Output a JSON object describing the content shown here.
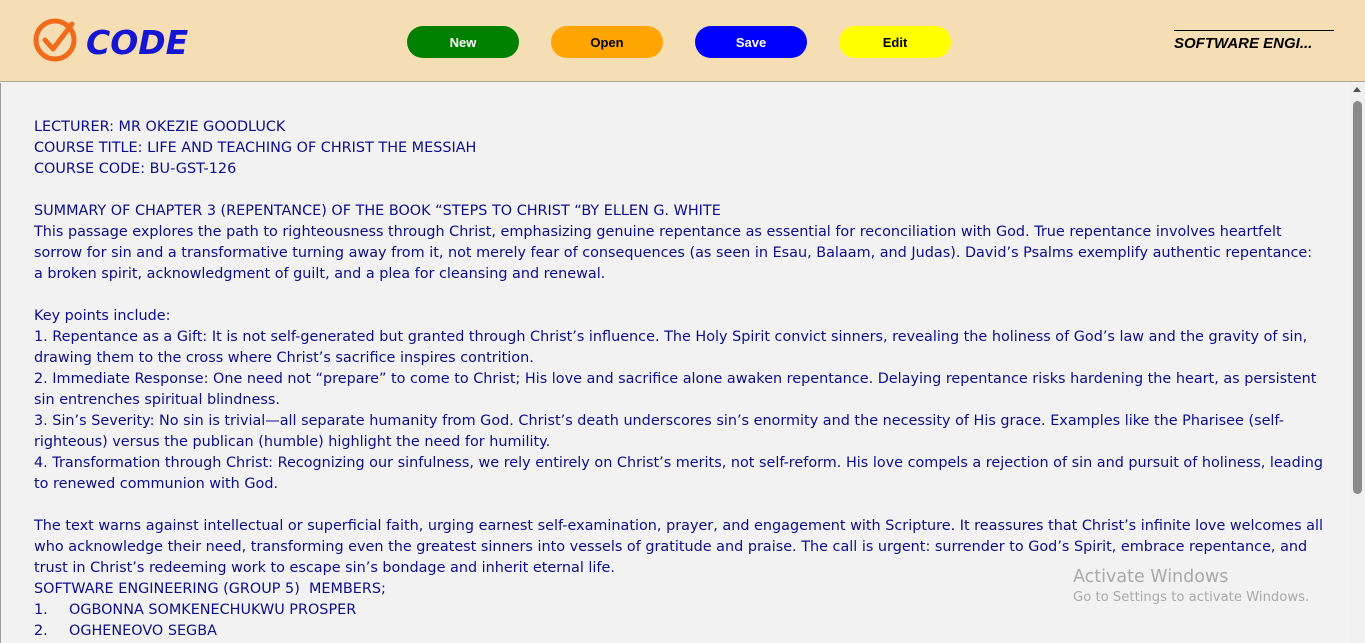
{
  "logo": {
    "icon": "check-circle-icon",
    "text": "CODE",
    "icon_color": "#f26b1d",
    "text_color": "#1515d4"
  },
  "toolbar": {
    "new_label": "New",
    "open_label": "Open",
    "save_label": "Save",
    "edit_label": "Edit",
    "colors": {
      "new": "#008000",
      "open": "#ffa500",
      "save": "#0000ff",
      "edit": "#ffff00"
    }
  },
  "brand_right": "SOFTWARE ENGI...",
  "document": {
    "lecturer": "LECTURER: MR OKEZIE GOODLUCK",
    "course_title": "COURSE TITLE: LIFE AND TEACHING OF CHRIST THE MESSIAH",
    "course_code": "COURSE CODE: BU-GST-126",
    "summary_heading": "SUMMARY OF CHAPTER 3 (REPENTANCE) OF THE BOOK “STEPS TO CHRIST “BY ELLEN G. WHITE",
    "intro": "This passage explores the path to righteousness through Christ, emphasizing genuine repentance as essential for reconciliation with God. True repentance involves heartfelt sorrow for sin and a transformative turning away from it, not merely fear of consequences (as seen in Esau, Balaam, and Judas). David’s Psalms exemplify authentic repentance: a broken spirit, acknowledgment of guilt, and a plea for cleansing and renewal.",
    "key_points_heading": "Key points include:",
    "points": [
      "1. Repentance as a Gift: It is not self-generated but granted through Christ’s influence. The Holy Spirit convict sinners, revealing the holiness of God’s law and the gravity of sin, drawing them to the cross where Christ’s sacrifice inspires contrition.",
      "2. Immediate Response: One need not “prepare” to come to Christ; His love and sacrifice alone awaken repentance. Delaying repentance risks hardening the heart, as persistent sin entrenches spiritual blindness.",
      "3. Sin’s Severity: No sin is trivial—all separate humanity from God. Christ’s death underscores sin’s enormity and the necessity of His grace. Examples like the Pharisee (self-righteous) versus the publican (humble) highlight the need for humility.",
      "4. Transformation through Christ: Recognizing our sinfulness, we rely entirely on Christ’s merits, not self-reform. His love compels a rejection of sin and pursuit of holiness, leading to renewed communion with God."
    ],
    "conclusion": "The text warns against intellectual or superficial faith, urging earnest self-examination, prayer, and engagement with Scripture. It reassures that Christ’s infinite love welcomes all who acknowledge their need, transforming even the greatest sinners into vessels of gratitude and praise. The call is urgent: surrender to God’s Spirit, embrace repentance, and trust in Christ’s redeeming work to escape sin’s bondage and inherit eternal life.",
    "members_heading": "SOFTWARE ENGINEERING (GROUP 5)  MEMBERS;",
    "members": [
      {
        "num": "1.",
        "name": "OGBONNA SOMKENECHUKWU PROSPER"
      },
      {
        "num": "2.",
        "name": "OGHENEOVO SEGBA"
      }
    ]
  },
  "watermark": {
    "title": "Activate Windows",
    "subtitle": "Go to Settings to activate Windows."
  }
}
